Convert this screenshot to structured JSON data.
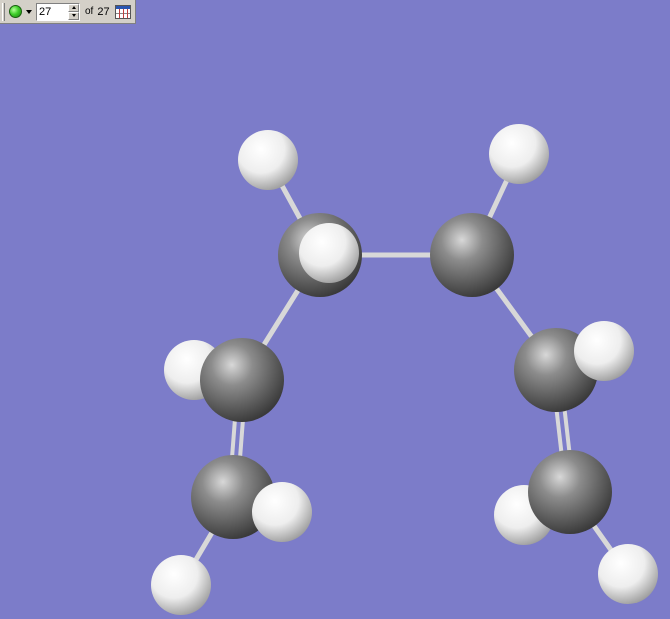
{
  "toolbar": {
    "frame_value": "27",
    "of_label": "of",
    "total_frames": "27",
    "play_icon": "green-ball-play-icon",
    "spreadsheet_icon": "spreadsheet-icon"
  },
  "viewport": {
    "background_color": "#7c7cc9"
  },
  "molecule": {
    "atoms": [
      {
        "id": "C1",
        "element": "C"
      },
      {
        "id": "C2",
        "element": "C"
      },
      {
        "id": "C3",
        "element": "C"
      },
      {
        "id": "C4",
        "element": "C"
      },
      {
        "id": "C5",
        "element": "C"
      },
      {
        "id": "C6",
        "element": "C"
      },
      {
        "id": "H1",
        "element": "H"
      },
      {
        "id": "H2",
        "element": "H"
      },
      {
        "id": "H3",
        "element": "H"
      },
      {
        "id": "H4",
        "element": "H"
      },
      {
        "id": "H5",
        "element": "H"
      },
      {
        "id": "H6",
        "element": "H"
      },
      {
        "id": "H7",
        "element": "H"
      },
      {
        "id": "H8",
        "element": "H"
      },
      {
        "id": "H9",
        "element": "H"
      },
      {
        "id": "H10",
        "element": "H"
      }
    ],
    "bonds": [
      {
        "a": "C1",
        "b": "C2",
        "order": 1
      },
      {
        "a": "C1",
        "b": "C3",
        "order": 1
      },
      {
        "a": "C2",
        "b": "C4",
        "order": 1
      },
      {
        "a": "C3",
        "b": "C5",
        "order": 2
      },
      {
        "a": "C4",
        "b": "C6",
        "order": 2
      },
      {
        "a": "C1",
        "b": "H1",
        "order": 1
      },
      {
        "a": "C2",
        "b": "H2",
        "order": 1
      },
      {
        "a": "C5",
        "b": "H7",
        "order": 1
      },
      {
        "a": "C6",
        "b": "H10",
        "order": 1
      }
    ],
    "colors": {
      "carbon": "#8a8a8a",
      "hydrogen": "#f2f2f2",
      "bond": "#d8d8d8"
    }
  }
}
